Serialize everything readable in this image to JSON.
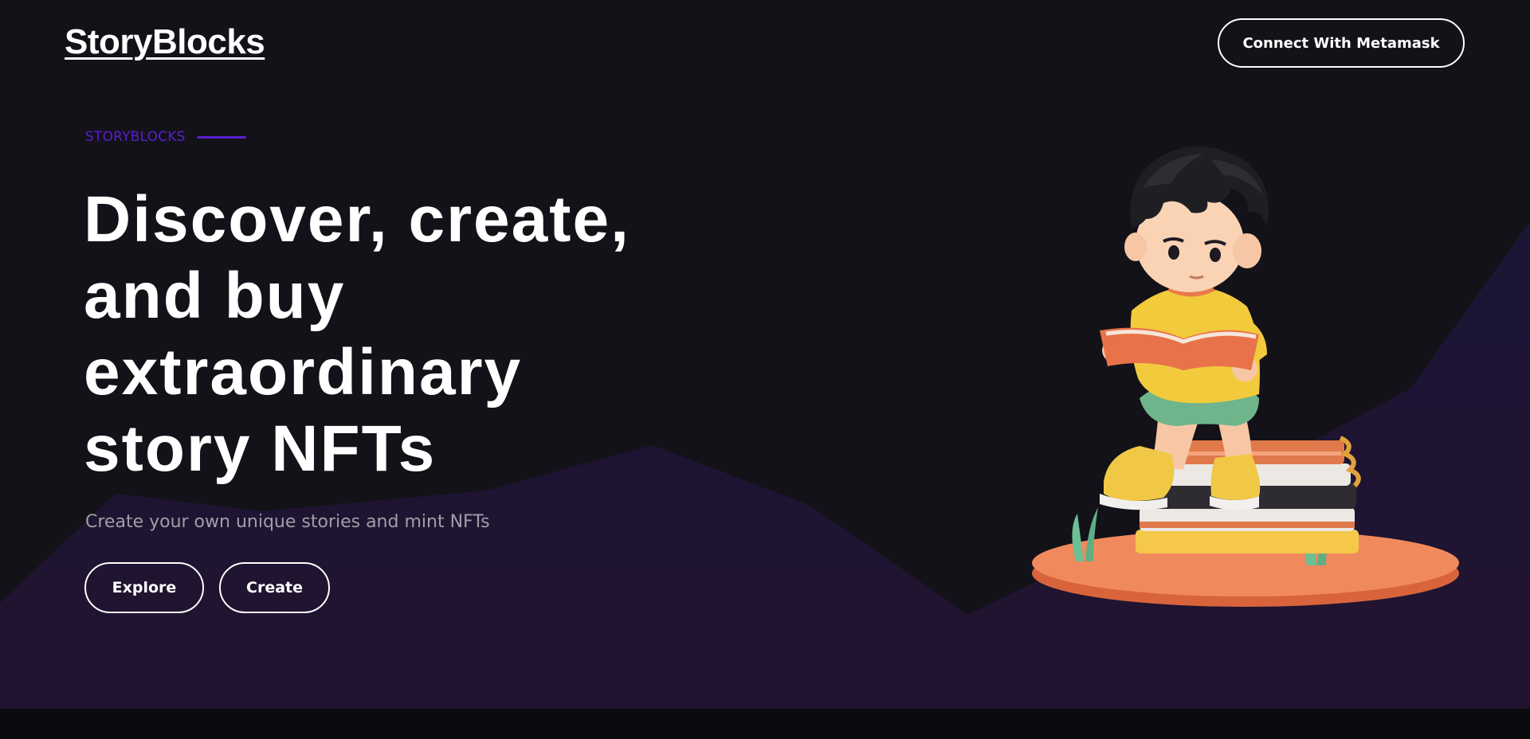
{
  "header": {
    "logo_text": "StoryBlocks",
    "connect_button_label": "Connect With Metamask"
  },
  "hero": {
    "eyebrow": "STORYBLOCKS",
    "headline_lines": [
      "Discover, create,",
      "and buy",
      "extraordinary",
      "story NFTs"
    ],
    "subtitle": "Create your own unique stories and mint NFTs",
    "buttons": {
      "explore_label": "Explore",
      "create_label": "Create"
    }
  },
  "colors": {
    "background": "#131218",
    "accent": "#5a1fd1",
    "mountain": "#1c1533",
    "text": "#ffffff",
    "muted_text": "#a09fa8"
  },
  "icons": {
    "illustration": "boy-reading-on-books-illustration"
  }
}
